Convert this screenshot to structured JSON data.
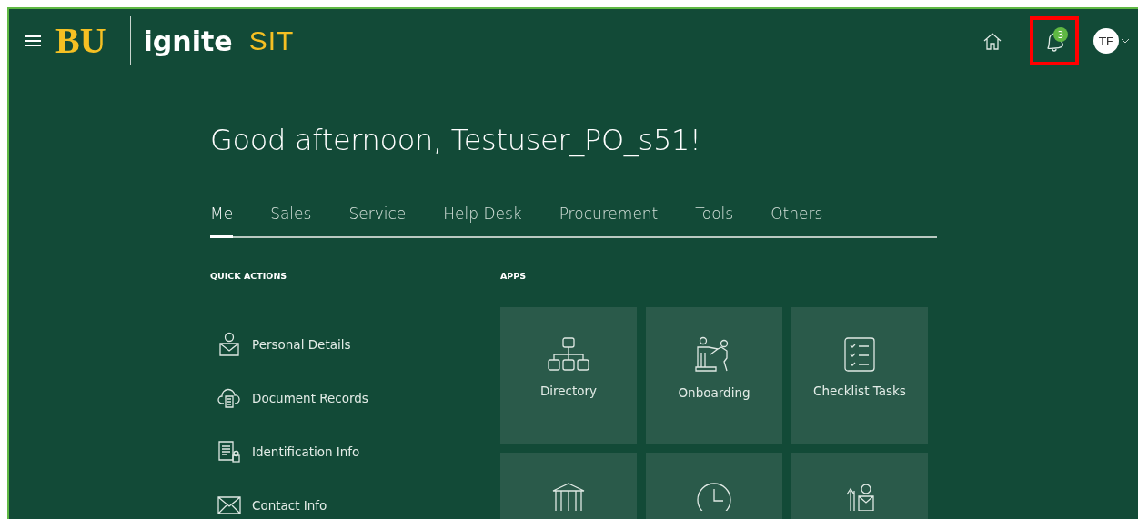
{
  "header": {
    "logo_mark": "BU",
    "app_name": "ignite",
    "environment": "SIT",
    "notifications": {
      "count": "3",
      "highlighted": true
    },
    "avatar": "TE"
  },
  "greeting": "Good afternoon, Testuser_PO_s51!",
  "tabs": [
    {
      "label": "Me",
      "selected": true
    },
    {
      "label": "Sales",
      "selected": false
    },
    {
      "label": "Service",
      "selected": false
    },
    {
      "label": "Help Desk",
      "selected": false
    },
    {
      "label": "Procurement",
      "selected": false
    },
    {
      "label": "Tools",
      "selected": false
    },
    {
      "label": "Others",
      "selected": false
    }
  ],
  "quick_actions": {
    "title": "QUICK ACTIONS",
    "items": [
      {
        "label": "Personal Details"
      },
      {
        "label": "Document Records"
      },
      {
        "label": "Identification Info"
      },
      {
        "label": "Contact Info"
      }
    ]
  },
  "apps": {
    "title": "APPS",
    "tiles": [
      {
        "kind": "labeled",
        "label": "Directory"
      },
      {
        "kind": "labeled",
        "label": "Onboarding"
      },
      {
        "kind": "labeled",
        "label": "Checklist Tasks"
      },
      {
        "kind": "icon_only"
      },
      {
        "kind": "icon_only"
      },
      {
        "kind": "icon_only"
      }
    ]
  }
}
